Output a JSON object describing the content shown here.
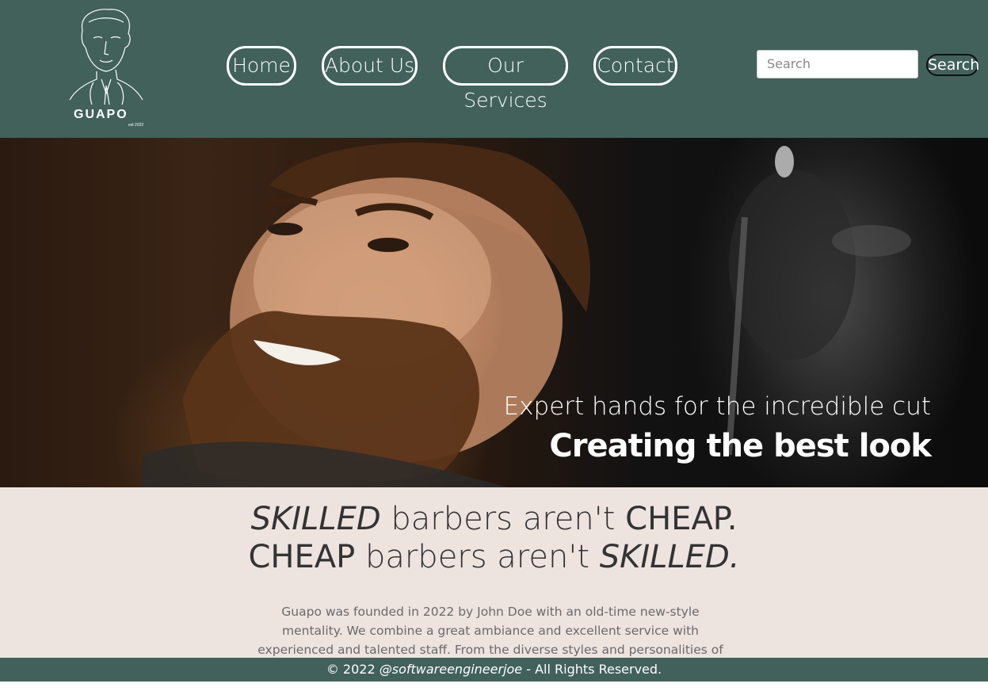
{
  "brand": {
    "name": "GUAPO",
    "est": "est 2022"
  },
  "nav": [
    {
      "label": "Home"
    },
    {
      "label": "About Us"
    },
    {
      "label": "Our Services"
    },
    {
      "label": "Contact"
    }
  ],
  "search": {
    "placeholder": "Search",
    "button_label": "Search"
  },
  "hero": {
    "subtitle": "Expert hands for the incredible cut",
    "title": "Creating the best look"
  },
  "about": {
    "tagline_line1": {
      "word1": "SKILLED",
      "middle": " barbers aren't ",
      "word2": "CHEAP."
    },
    "tagline_line2": {
      "word1": "CHEAP",
      "middle": " barbers aren't ",
      "word2": "SKILLED."
    },
    "paragraph": "Guapo was founded in 2022 by John Doe with an old-time new-style mentality. We combine a great ambiance and excellent service with experienced and talented staff. From the diverse styles and personalities of our barbers, Guapo is the place"
  },
  "footer": {
    "prefix": "© 2022 ",
    "handle": "@softwareengineerjoe",
    "suffix": " - All Rights Reserved."
  },
  "colors": {
    "header_bg": "#41615a",
    "about_bg": "#ede3df",
    "text_dark": "#333333"
  }
}
